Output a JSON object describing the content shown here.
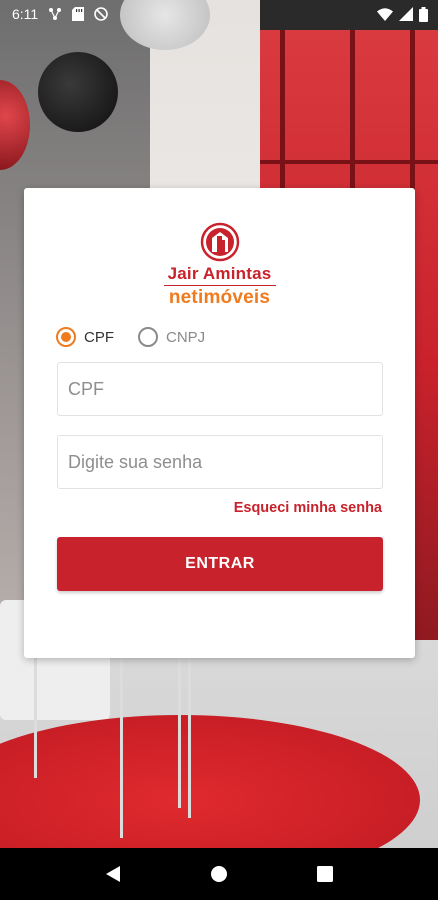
{
  "status_bar": {
    "time": "6:11",
    "icons_left": [
      "network-share-icon",
      "sd-card-icon",
      "do-not-disturb-icon"
    ],
    "icons_right": [
      "wifi-icon",
      "signal-icon",
      "battery-icon"
    ]
  },
  "brand": {
    "line1": "Jair Amintas",
    "line2": "netimóveis",
    "primary_color": "#c8232c",
    "accent_color": "#f07b1f"
  },
  "login_form": {
    "doc_type_options": [
      {
        "label": "CPF",
        "selected": true
      },
      {
        "label": "CNPJ",
        "selected": false
      }
    ],
    "cpf_field": {
      "value": "",
      "placeholder": "CPF"
    },
    "password_field": {
      "value": "",
      "placeholder": "Digite sua senha"
    },
    "forgot_password_label": "Esqueci minha senha",
    "submit_label": "ENTRAR"
  },
  "nav_bar": {
    "buttons": [
      "back-icon",
      "home-icon",
      "recents-icon"
    ]
  }
}
